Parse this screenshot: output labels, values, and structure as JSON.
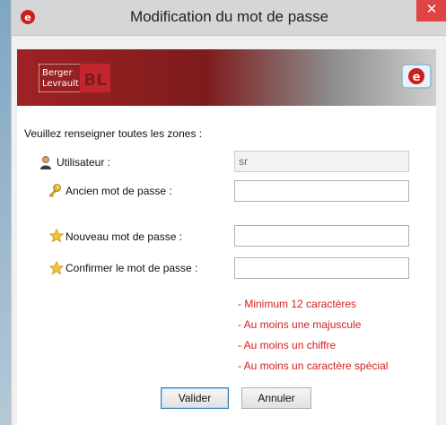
{
  "window": {
    "title": "Modification du mot de passe",
    "close_glyph": "✕"
  },
  "banner": {
    "brand_line1": "Berger",
    "brand_line2": "Levrault",
    "brand_mark": "BL"
  },
  "form": {
    "intro": "Veuillez renseigner toutes les zones :",
    "user_label": "Utilisateur :",
    "user_value": "sr",
    "old_password_label": "Ancien mot de passe :",
    "old_password_value": "",
    "new_password_label": "Nouveau mot de passe :",
    "new_password_value": "",
    "confirm_password_label": "Confirmer le mot de passe :",
    "confirm_password_value": ""
  },
  "rules": [
    "- Minimum 12 caractères",
    "- Au moins une majuscule",
    "- Au moins un chiffre",
    "- Au moins un caractère spécial"
  ],
  "buttons": {
    "validate": "Valider",
    "cancel": "Annuler"
  },
  "colors": {
    "rule_text": "#d32020",
    "close_bg": "#e04343",
    "brand_red": "#9e2224"
  },
  "icons": [
    "app-logo-icon",
    "close-icon",
    "user-icon",
    "key-icon",
    "star-icon",
    "star-icon",
    "e-logo-icon"
  ]
}
